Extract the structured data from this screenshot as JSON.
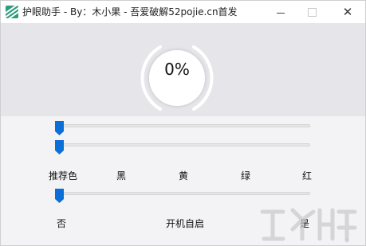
{
  "window": {
    "title": "护眼助手 - By：木小果 - 吾爱破解52pojie.cn首发"
  },
  "gauge": {
    "percent_text": "0%",
    "level": 0
  },
  "sliders": [
    {
      "name": "slider-top",
      "value": 0
    },
    {
      "name": "slider-color",
      "value": 0
    },
    {
      "name": "slider-autostart",
      "value": 0
    }
  ],
  "color_labels": [
    "推荐色",
    "黑",
    "黄",
    "绿",
    "红"
  ],
  "autostart": {
    "no_label": "否",
    "title": "开机自启",
    "yes_label": "是"
  },
  "colors": {
    "accent": "#0a6fd6",
    "icon": "#2e9a7e",
    "background": "#f3f3f5",
    "top_panel": "#e6e6ea"
  },
  "icons": [
    "app-icon",
    "minimize-icon",
    "maximize-icon",
    "close-icon"
  ]
}
